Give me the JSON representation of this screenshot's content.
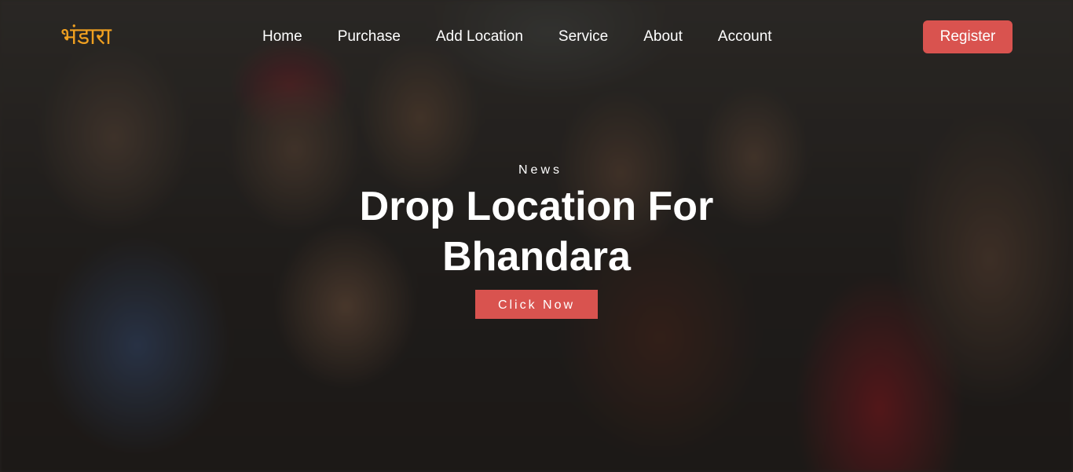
{
  "navbar": {
    "logo": "भंडारा",
    "links": [
      "Home",
      "Purchase",
      "Add Location",
      "Service",
      "About",
      "Account"
    ],
    "register_label": "Register"
  },
  "hero": {
    "eyebrow": "News",
    "headline": "Drop Location For Bhandara",
    "cta_label": "Click Now",
    "background_image": "crowd-receiving-food-photo"
  },
  "colors": {
    "accent": "#d9534f",
    "logo": "#f0a020",
    "text": "#ffffff"
  }
}
